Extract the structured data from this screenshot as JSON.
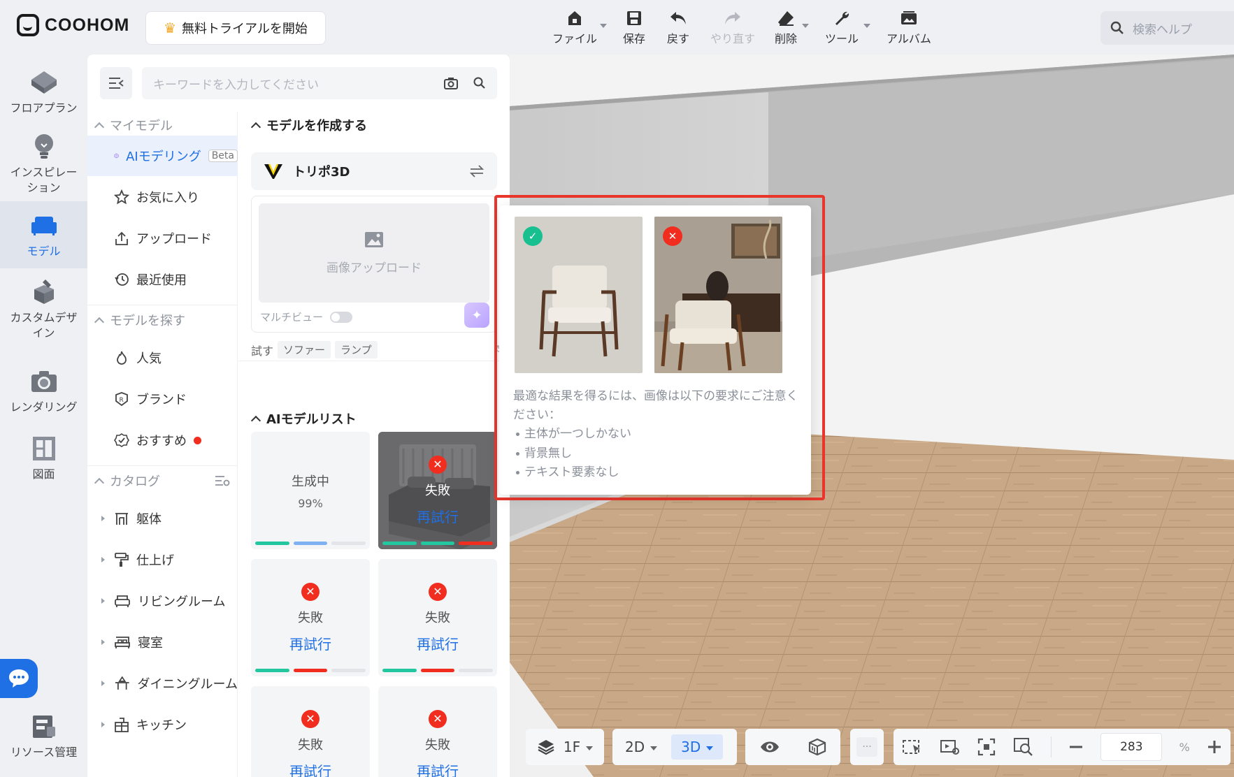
{
  "brand": {
    "name": "COOHOM",
    "trial_label": "無料トライアルを開始"
  },
  "toolbar": {
    "file": "ファイル",
    "save": "保存",
    "undo": "戻す",
    "redo": "やり直す",
    "delete": "削除",
    "tools": "ツール",
    "album": "アルバム",
    "search_help": "検索ヘルプ"
  },
  "leftnav": {
    "floorplan": "フロアプラン",
    "inspiration": "インスピレーション",
    "model": "モデル",
    "custom_design": "カスタムデザイン",
    "rendering": "レンダリング",
    "drawing": "図面",
    "resources": "リソース管理"
  },
  "panel": {
    "search_placeholder": "キーワードを入力してください",
    "my_models": {
      "title": "マイモデル",
      "ai_modeling": "AIモデリング",
      "beta": "Beta",
      "favorites": "お気に入り",
      "upload": "アップロード",
      "recent": "最近使用"
    },
    "find_models": {
      "title": "モデルを探す",
      "popular": "人気",
      "brand": "ブランド",
      "recommended": "おすすめ"
    },
    "catalog": {
      "title": "カタログ",
      "items": [
        "躯体",
        "仕上げ",
        "リビングルーム",
        "寝室",
        "ダイニングルーム",
        "キッチン"
      ]
    },
    "create": {
      "title": "モデルを作成する",
      "provider": "トリポ3D",
      "upload_image": "画像アップロード",
      "multiview": "マルチビュー",
      "try_label": "試す",
      "chips": [
        "ソファー",
        "ランプ"
      ]
    },
    "ai_list": {
      "title": "AIモデルリスト",
      "generating": "生成中",
      "progress": "99%",
      "failed": "失敗",
      "retry": "再試行"
    }
  },
  "popover": {
    "tip_intro": "最適な結果を得るには、画像は以下の要求にご注意ください：",
    "requirements": [
      "主体が一つしかない",
      "背景無し",
      "テキスト要素なし"
    ]
  },
  "bottombar": {
    "floor": "1F",
    "mode_2d": "2D",
    "mode_3d": "3D",
    "more": "···",
    "zoom_value": "283",
    "zoom_unit": "%"
  },
  "colors": {
    "accent": "#1f6fe5",
    "error": "#f02d1e",
    "success": "#18c08f",
    "highlight_outline": "#e8362c"
  }
}
